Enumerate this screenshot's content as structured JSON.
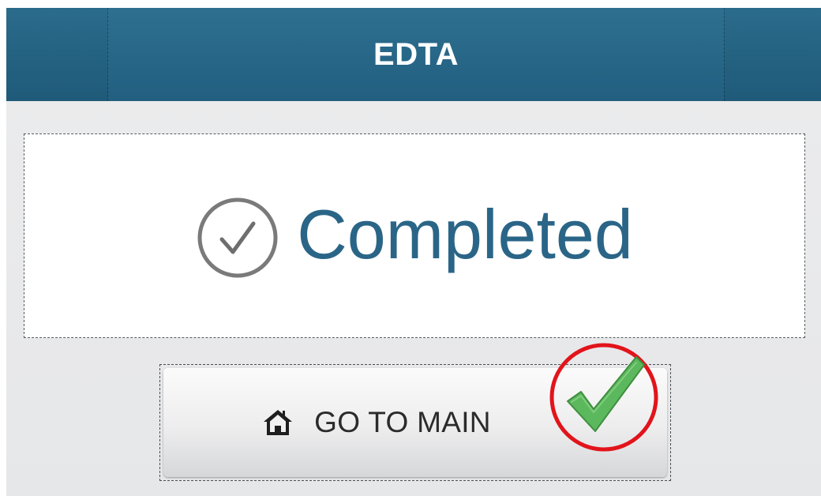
{
  "header": {
    "title": "EDTA"
  },
  "status": {
    "icon": "check-circle-icon",
    "text": "Completed",
    "text_color": "#2a6587"
  },
  "main_button": {
    "icon": "home-icon",
    "label": "GO TO MAIN"
  },
  "annotation": {
    "icon": "green-checkmark-icon",
    "circle_color": "#e2141b",
    "check_color": "#5cb85c"
  },
  "colors": {
    "header_bg": "#2a6a8a",
    "background": "#e8e9ea"
  }
}
